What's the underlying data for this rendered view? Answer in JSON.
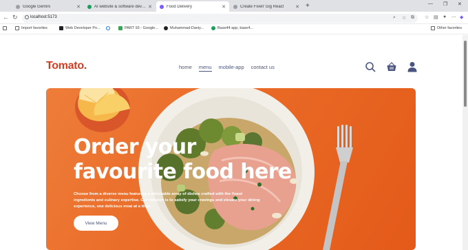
{
  "browser": {
    "tabs": [
      {
        "label": "Google Gemini",
        "color": "#9aa0a6"
      },
      {
        "label": "AI website & software developme",
        "color": "#1a9e5c"
      },
      {
        "label": "Food Delivery",
        "color": "#7b5cff"
      },
      {
        "label": "Create Fiverr Gig React",
        "color": "#9aa0a6"
      }
    ],
    "address": "localhost:5173",
    "bookmarks": [
      {
        "label": "Import favorites",
        "color": "#5f6368"
      },
      {
        "label": "Web Developer Po...",
        "color": "#202124"
      },
      {
        "label": "",
        "color": "#1a73e8"
      },
      {
        "label": "PART 93 - Google...",
        "color": "#34a853"
      },
      {
        "label": "Muhammad-Daniy...",
        "color": "#202124"
      },
      {
        "label": "Base44 app, base4...",
        "color": "#1a9e5c"
      }
    ],
    "other_favorites": "Other favorites"
  },
  "site": {
    "logo": "Tomato.",
    "nav": [
      "home",
      "menu",
      "mobile-app",
      "contact us"
    ],
    "active_nav": "menu",
    "colors": {
      "brand": "#d63c21",
      "nav_text": "#49557e",
      "hero": "#e96a26"
    }
  },
  "hero": {
    "title_line1": "Order your",
    "title_line2": "favourite food here",
    "description": "Choose from a diverse menu featuring a delectable array of dishes crafted with the finest ingredients and culinary expertise. Our mission is to satisfy your cravings and elevate your dining experience, one delicious meal at a time.",
    "button": "View Menu"
  }
}
